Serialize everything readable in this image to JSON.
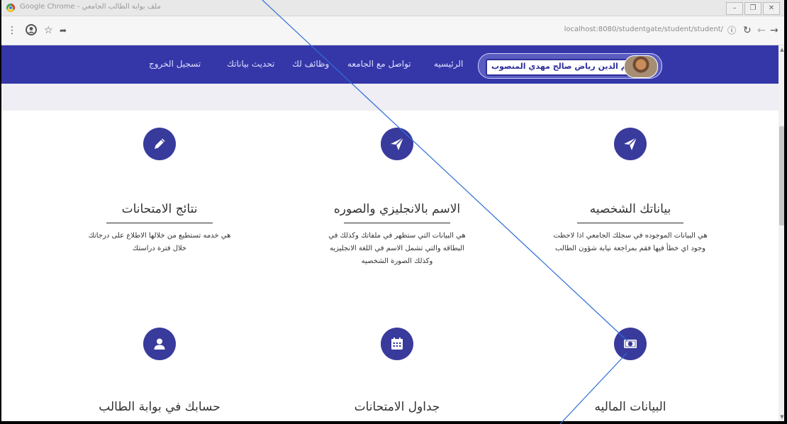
{
  "window": {
    "title": "Google Chrome - ملف بوابة الطالب الجامعي",
    "minimize": "–",
    "maximize": "❐",
    "close": "✕"
  },
  "toolbar": {
    "url": "localhost:8080/studentgate/student/student/",
    "icons": [
      "menu-icon",
      "account-icon",
      "bookmark-star-icon",
      "extension-icon",
      "info-icon",
      "reload-icon",
      "back-icon",
      "forward-icon"
    ]
  },
  "nav": {
    "user_name": "نجم الدين رياض صالح مهدي المنصوب",
    "links": [
      "الرئيسيه",
      "تواصل مع الجامعه",
      "وظائف لك",
      "تحديث بياناتك",
      "تسجيل الخروج"
    ]
  },
  "cards": [
    {
      "title": "بياناتك الشخصيه",
      "desc_line1": "هي البيانات الموجوده في سجلك الجامعي اذا لاحظت",
      "desc_line2": "وجود اي خطأ فيها فقم بمراجعة نيابة شؤون الطالب",
      "desc_line3": "",
      "icon": "paper-plane-icon"
    },
    {
      "title": "الاسم بالانجليزي والصوره",
      "desc_line1": "هي البيانات التي ستظهر في ملفاتك وكذلك في",
      "desc_line2": "البطاقه والتي تشمل الاسم في اللغة الانجليزيه",
      "desc_line3": "وكذلك الصورة الشخصيه",
      "icon": "paper-plane-icon"
    },
    {
      "title": "نتائج الامتحانات",
      "desc_line1": "هي خدمه تستطيع من خلالها الاطلاع على درجاتك",
      "desc_line2": "خلال فترة دراستك",
      "desc_line3": "",
      "icon": "pencil-icon"
    },
    {
      "title": "البيانات الماليه",
      "icon": "money-icon"
    },
    {
      "title": "جداول الامتحانات",
      "icon": "calendar-icon"
    },
    {
      "title": "حسابك في بوابة الطالب",
      "icon": "user-icon"
    }
  ],
  "colors": {
    "navbar": "#3537a8",
    "icon_circle": "#383a9c",
    "annotation_line": "#2f6fd6"
  }
}
